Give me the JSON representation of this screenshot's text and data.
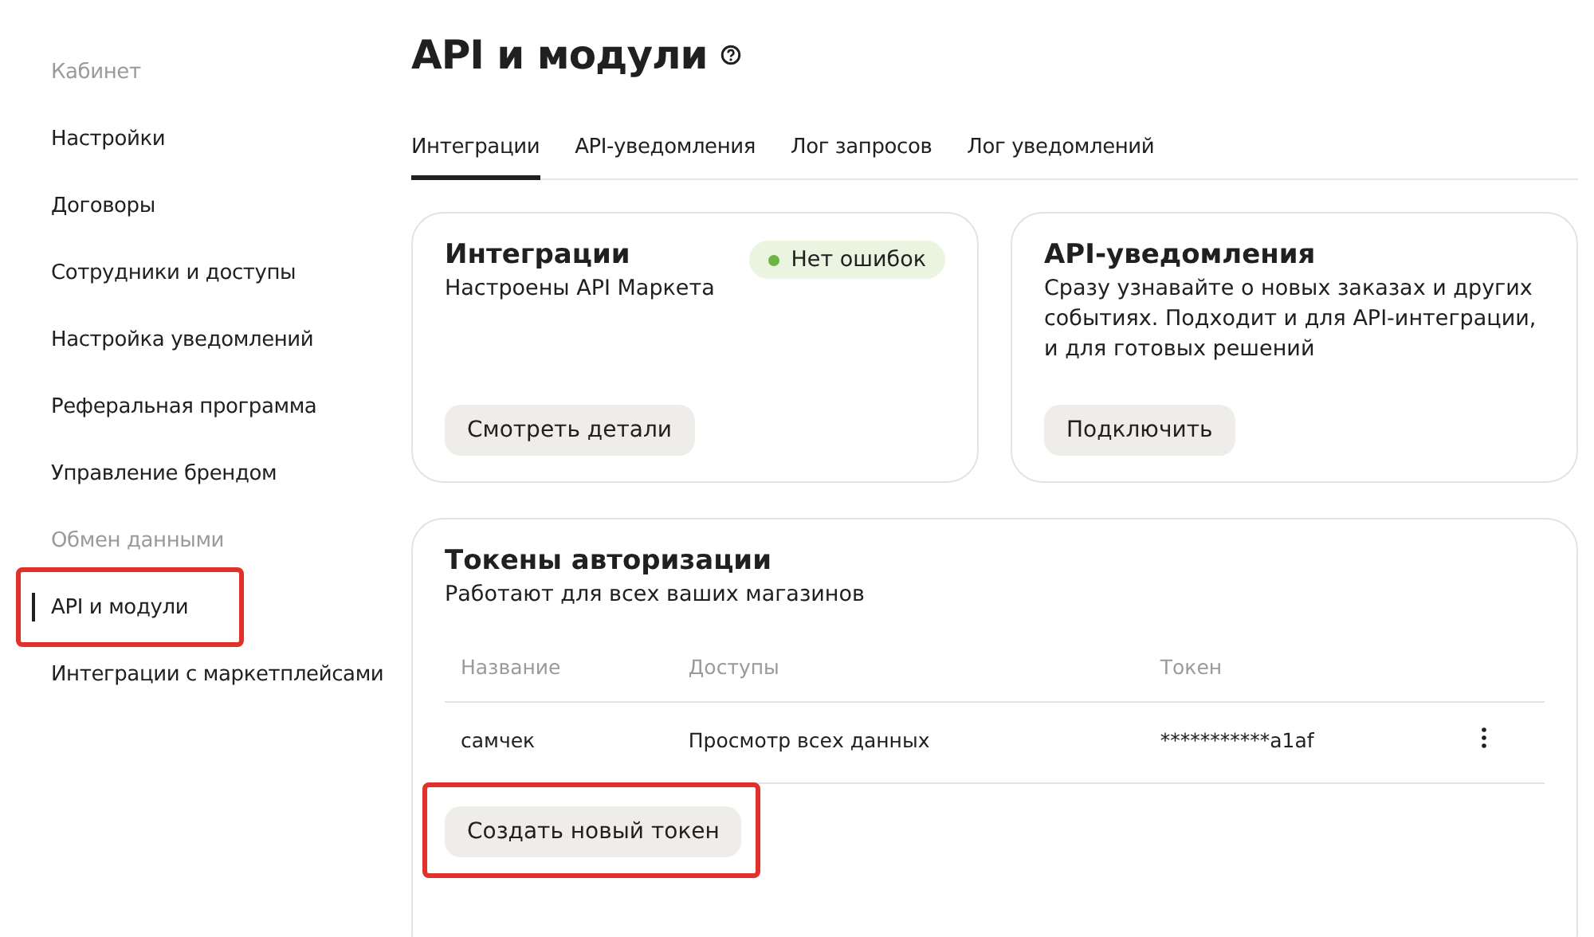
{
  "sidebar": {
    "items": [
      {
        "label": "Кабинет",
        "kind": "header",
        "selected": false,
        "highlighted": false
      },
      {
        "label": "Настройки",
        "kind": "link",
        "selected": false,
        "highlighted": false
      },
      {
        "label": "Договоры",
        "kind": "link",
        "selected": false,
        "highlighted": false
      },
      {
        "label": "Сотрудники и доступы",
        "kind": "link",
        "selected": false,
        "highlighted": false
      },
      {
        "label": "Настройка уведомлений",
        "kind": "link",
        "selected": false,
        "highlighted": false
      },
      {
        "label": "Реферальная программа",
        "kind": "link",
        "selected": false,
        "highlighted": false
      },
      {
        "label": "Управление брендом",
        "kind": "link",
        "selected": false,
        "highlighted": false
      },
      {
        "label": "Обмен данными",
        "kind": "header",
        "selected": false,
        "highlighted": false
      },
      {
        "label": "API и модули",
        "kind": "link",
        "selected": true,
        "highlighted": true
      },
      {
        "label": "Интеграции с маркетплейсами",
        "kind": "link",
        "selected": false,
        "highlighted": false
      }
    ]
  },
  "page": {
    "title": "API и модули"
  },
  "tabs": [
    {
      "label": "Интеграции",
      "selected": true
    },
    {
      "label": "API-уведомления",
      "selected": false
    },
    {
      "label": "Лог запросов",
      "selected": false
    },
    {
      "label": "Лог уведомлений",
      "selected": false
    }
  ],
  "cards": [
    {
      "title": "Интеграции",
      "text": "Настроены API Маркета",
      "status": {
        "label": "Нет ошибок",
        "color": "#6cb543"
      },
      "button": "Смотреть детали"
    },
    {
      "title": "API-уведомления",
      "text": "Сразу узнавайте о новых заказах и других событиях. Подходит и для API-интеграции, и для готовых решений",
      "button": "Подключить"
    }
  ],
  "tokens": {
    "title": "Токены авторизации",
    "subtitle": "Работают для всех ваших магазинов",
    "columns": [
      "Название",
      "Доступы",
      "Токен"
    ],
    "rows": [
      [
        "самчек",
        "Просмотр всех данных",
        "***********a1af"
      ]
    ],
    "button": {
      "label": "Создать новый токен",
      "highlighted": true
    }
  }
}
